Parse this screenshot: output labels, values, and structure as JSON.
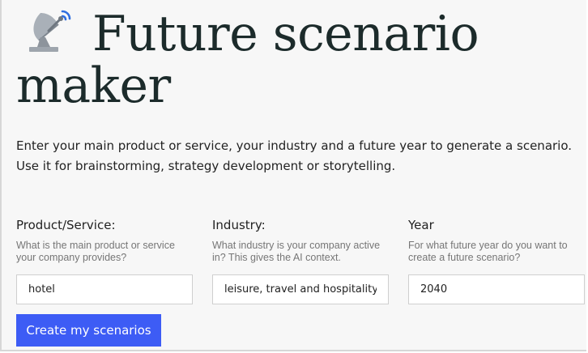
{
  "page": {
    "title": "Future scenario maker",
    "title_icon": "satellite-dish-icon",
    "intro": "Enter your main product or service, your industry and a future year to generate a scenario. Use it for brainstorming, strategy development or storytelling."
  },
  "form": {
    "fields": [
      {
        "label": "Product/Service:",
        "help": "What is the main product or service your company provides?",
        "value": "hotel"
      },
      {
        "label": "Industry:",
        "help": "What industry is your company active in? This gives the AI context.",
        "value": "leisure, travel and hospitality"
      },
      {
        "label": "Year",
        "help": "For what future year do you want to create a future scenario?",
        "value": "2040"
      }
    ],
    "submit_label": "Create my scenarios"
  },
  "colors": {
    "accent": "#3d5cf5",
    "title_text": "#1c2b2b",
    "background": "#f7f7f7"
  }
}
